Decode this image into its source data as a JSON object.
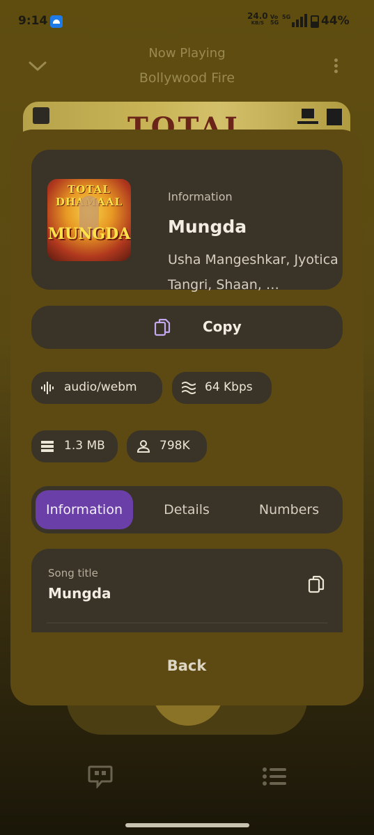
{
  "status_bar": {
    "time": "9:14",
    "net_speed": "24.0",
    "net_unit": "KB/S",
    "volte": "Vo\n5G",
    "network": "5G",
    "battery": "44%"
  },
  "now_playing": {
    "title": "Now Playing",
    "playlist": "Bollywood Fire"
  },
  "sheet": {
    "header_label": "Information",
    "song_title": "Mungda",
    "artists": "Usha Mangeshkar, Jyotica Tangri, Shaan, …",
    "art_top": "TOTAL DHAMAAL",
    "art_bottom": "MUNGDA",
    "copy_label": "Copy",
    "chips": {
      "format": "audio/webm",
      "bitrate": "64 Kbps",
      "size": "1.3 MB",
      "listeners": "798K"
    },
    "tabs": [
      "Information",
      "Details",
      "Numbers"
    ],
    "active_tab": "Information",
    "field_key": "Song title",
    "field_value": "Mungda",
    "back_label": "Back"
  },
  "colors": {
    "accent": "#6a3fa8",
    "sheet_bg": "#5c4a12",
    "card_bg": "#3a3327",
    "icon_purple": "#c4a8f0"
  }
}
